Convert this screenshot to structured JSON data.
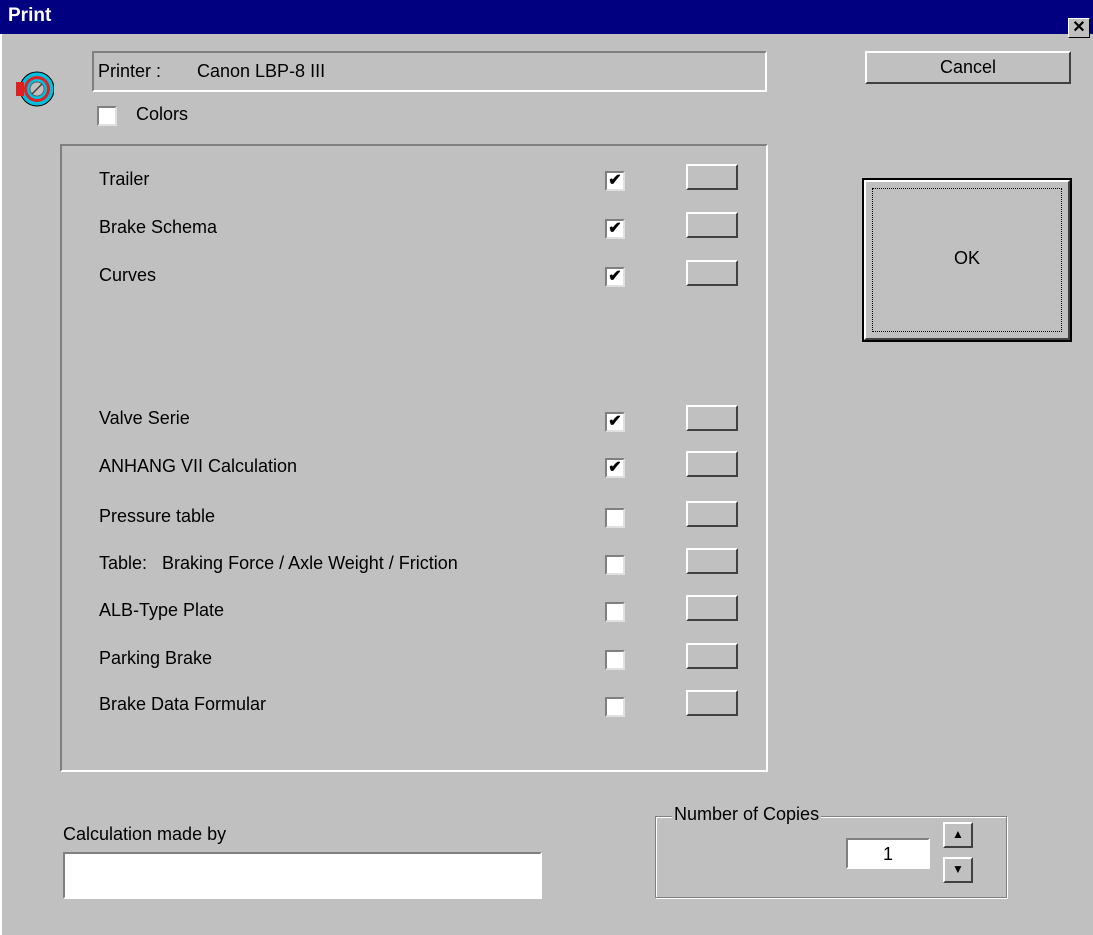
{
  "window": {
    "title": "Print",
    "close_glyph": "✕"
  },
  "printer": {
    "label": "Printer :",
    "name": "Canon LBP-8 III"
  },
  "colors": {
    "label": "Colors",
    "checked": false
  },
  "buttons": {
    "cancel": "Cancel",
    "ok": "OK"
  },
  "items": [
    {
      "label": "Trailer",
      "checked": true
    },
    {
      "label": "Brake Schema",
      "checked": true
    },
    {
      "label": "Curves",
      "checked": true
    },
    {
      "label": "Valve Serie",
      "checked": true
    },
    {
      "label": "ANHANG VII Calculation",
      "checked": true
    },
    {
      "label": "Pressure table",
      "checked": false
    },
    {
      "label": "Table:   Braking Force / Axle Weight / Friction",
      "checked": false
    },
    {
      "label": "ALB-Type Plate",
      "checked": false
    },
    {
      "label": "Parking Brake",
      "checked": false
    },
    {
      "label": "Brake Data Formular",
      "checked": false
    }
  ],
  "calculation": {
    "label": "Calculation made by",
    "value": ""
  },
  "copies": {
    "label": "Number of Copies",
    "value": "1",
    "up_glyph": "▲",
    "down_glyph": "▼"
  },
  "icons": {
    "app": "target-icon"
  },
  "colors_theme": {
    "titlebar": "#000080",
    "face": "#c0c0c0"
  }
}
